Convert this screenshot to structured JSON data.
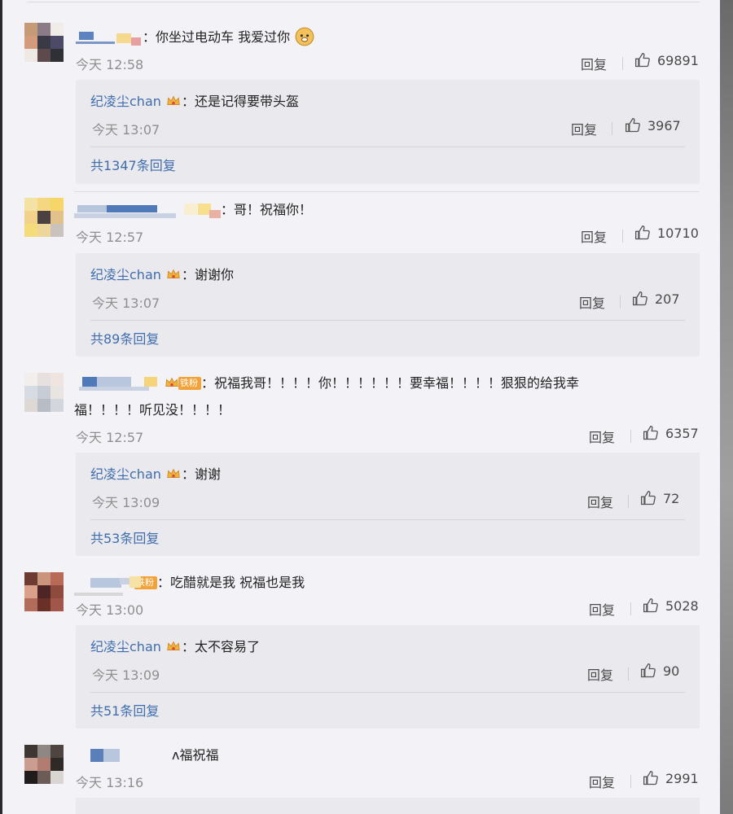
{
  "comments": [
    {
      "text": "你坐过电动车 我爱过你",
      "time": "今天 12:58",
      "reply_label": "回复",
      "likes": "69891",
      "reply": {
        "name": "纪凌尘chan",
        "text": "还是记得要带头盔",
        "time": "今天 13:07",
        "reply_label": "回复",
        "likes": "3967",
        "total": "共1347条回复"
      }
    },
    {
      "text": "哥！祝福你！",
      "time": "今天 12:57",
      "reply_label": "回复",
      "likes": "10710",
      "reply": {
        "name": "纪凌尘chan",
        "text": "谢谢你",
        "time": "今天 13:07",
        "reply_label": "回复",
        "likes": "207",
        "total": "共89条回复"
      }
    },
    {
      "badge": "铁粉",
      "text": "祝福我哥！！！！你！！！！！！要幸福！！！！狠狠的给我幸",
      "text2": "福！！！！听见没！！！！",
      "time": "今天 12:57",
      "reply_label": "回复",
      "likes": "6357",
      "reply": {
        "name": "纪凌尘chan",
        "text": "谢谢",
        "time": "今天 13:09",
        "reply_label": "回复",
        "likes": "72",
        "total": "共53条回复"
      }
    },
    {
      "badge": "铁粉",
      "text": "吃醋就是我 祝福也是我",
      "time": "今天 13:00",
      "reply_label": "回复",
      "likes": "5028",
      "reply": {
        "name": "纪凌尘chan",
        "text": "太不容易了",
        "time": "今天 13:09",
        "reply_label": "回复",
        "likes": "90",
        "total": "共51条回复"
      }
    },
    {
      "text": "ᴧ福祝福",
      "time": "今天 13:16",
      "reply_label": "回复",
      "likes": "2991"
    }
  ],
  "colors": {
    "link": "#3f6dae",
    "meta": "#8f8f8f",
    "badge": "#f3a237"
  },
  "icons": {
    "like": "thumbs-up-icon",
    "crown": "crown-icon",
    "emoji": "doge-emoji-icon"
  }
}
